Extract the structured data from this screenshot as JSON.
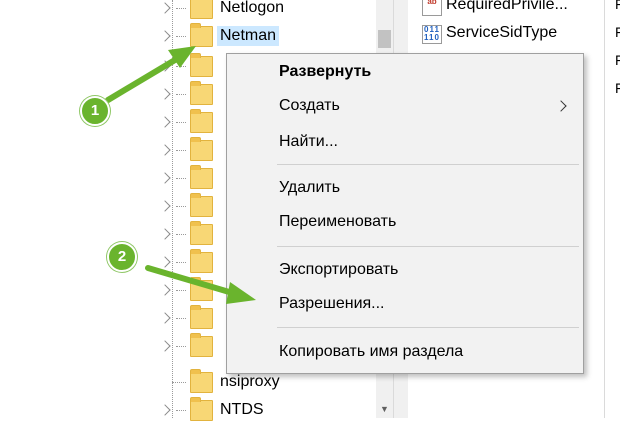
{
  "tree": {
    "items": [
      {
        "label": "Netlogon",
        "icon": "folder-icon",
        "selected": false
      },
      {
        "label": "Netman",
        "icon": "folder-icon",
        "selected": true
      },
      {
        "label": "",
        "icon": "folder-icon",
        "selected": false
      },
      {
        "label": "",
        "icon": "folder-icon",
        "selected": false
      },
      {
        "label": "",
        "icon": "folder-icon",
        "selected": false
      },
      {
        "label": "",
        "icon": "folder-icon",
        "selected": false
      },
      {
        "label": "",
        "icon": "folder-icon",
        "selected": false
      },
      {
        "label": "",
        "icon": "folder-icon",
        "selected": false
      },
      {
        "label": "",
        "icon": "folder-icon",
        "selected": false
      },
      {
        "label": "",
        "icon": "folder-icon",
        "selected": false
      },
      {
        "label": "",
        "icon": "folder-icon",
        "selected": false
      },
      {
        "label": "",
        "icon": "folder-icon",
        "selected": false
      },
      {
        "label": "",
        "icon": "folder-icon",
        "selected": false
      },
      {
        "label": "nsiproxy",
        "icon": "folder-icon",
        "selected": false
      },
      {
        "label": "NTDS",
        "icon": "folder-icon",
        "selected": false
      }
    ]
  },
  "values": {
    "items": [
      {
        "label": "RequiredPrivile...",
        "icon": "string-value-icon",
        "icon_text": "ab"
      },
      {
        "label": "ServiceSidType",
        "icon": "binary-value-icon",
        "icon_text": "011 110"
      }
    ],
    "right_column_chars": [
      "F",
      "F",
      "F",
      "F"
    ]
  },
  "context_menu": {
    "items": [
      {
        "label": "Развернуть",
        "bold": true
      },
      {
        "label": "Создать",
        "submenu": true
      },
      {
        "label": "Найти..."
      },
      {
        "label": "Удалить"
      },
      {
        "label": "Переименовать"
      },
      {
        "label": "Экспортировать"
      },
      {
        "label": "Разрешения..."
      },
      {
        "label": "Копировать имя раздела"
      }
    ]
  },
  "annotations": {
    "badge1": "1",
    "badge2": "2",
    "color": "#6ab42d"
  }
}
